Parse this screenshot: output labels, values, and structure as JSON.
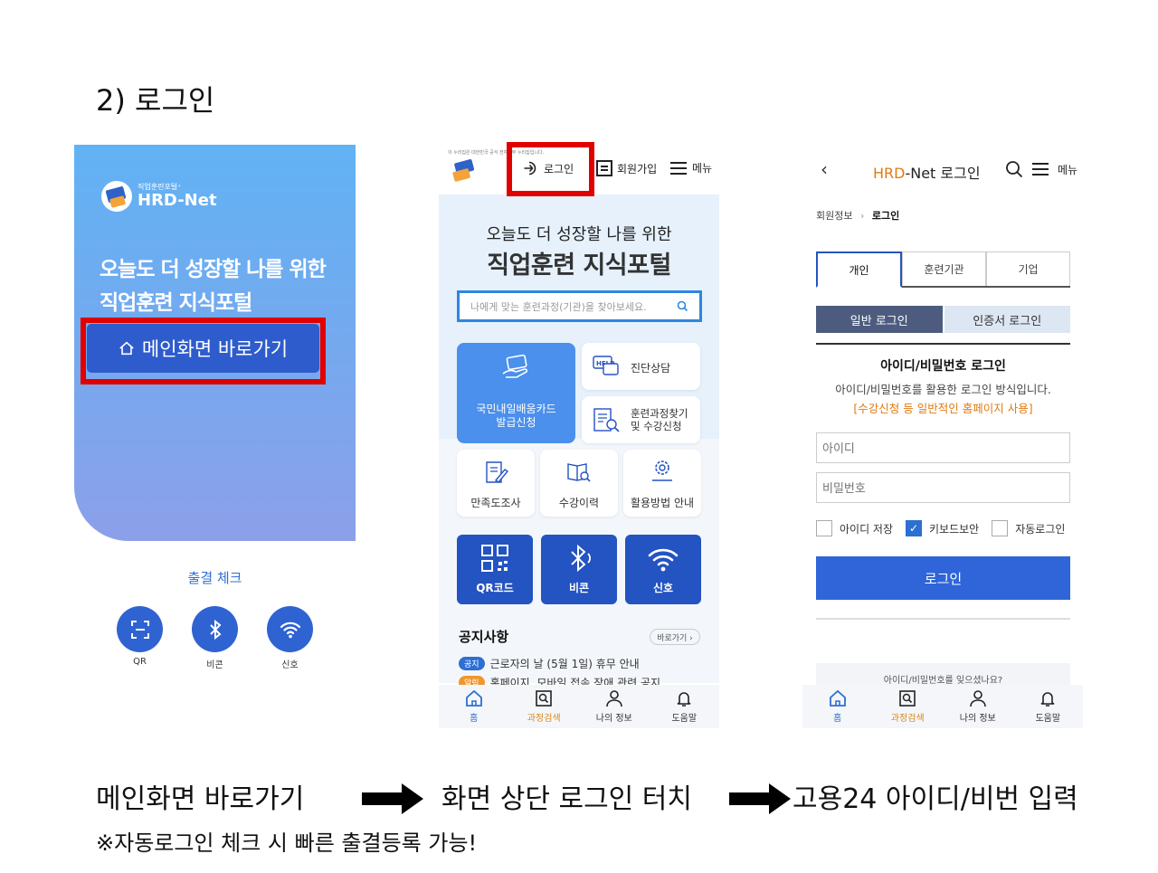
{
  "heading": "2) 로그인",
  "screen1": {
    "logo_small": "직업훈련포털⁺",
    "logo_big": "HRD-Net",
    "tagline_1": "오늘도 더 성장할 나를 위한",
    "tagline_2": "직업훈련 지식포털",
    "main_button": "메인화면 바로가기",
    "attendance_title": "출결 체크",
    "attendance_buttons": [
      "QR",
      "비콘",
      "신호"
    ]
  },
  "screen2": {
    "top_notice": "이 누리집은 대한민국 공식 전자정부 누리집입니다.",
    "login": "로그인",
    "join": "회원가입",
    "menu": "메뉴",
    "subtitle": "오늘도 더 성장할 나를 위한",
    "title": "직업훈련 지식포털",
    "search_placeholder": "나에게 맞는 훈련과정(기관)을 찾아보세요.",
    "tile_card": "국민내일배움카드 발급신청",
    "tile_card_line1": "국민내일배움카드",
    "tile_card_line2": "발급신청",
    "tile_diag": "진단상담",
    "tile_search_line1": "훈련과정찾기",
    "tile_search_line2": "및 수강신청",
    "tile_survey": "만족도조사",
    "tile_history": "수강이력",
    "tile_guide": "활용방법 안내",
    "att_qr": "QR코드",
    "att_beacon": "비콘",
    "att_signal": "신호",
    "notice_title": "공지사항",
    "notice_more": "바로가기 ›",
    "notices": [
      {
        "badge": "공지",
        "text": "근로자의 날 (5월 1일) 휴무 안내",
        "color": "#2e6fd2"
      },
      {
        "badge": "알림",
        "text": "홈페이지, 모바일 접속 장애 관련 공지",
        "color": "#f0962a"
      }
    ],
    "nav": [
      "홈",
      "과정검색",
      "나의 정보",
      "도움말"
    ]
  },
  "screen3": {
    "title_hrd": "HRD",
    "title_rest": "-Net 로그인",
    "menu": "메뉴",
    "crumb_1": "회원정보",
    "crumb_2": "로그인",
    "tabs": [
      "개인",
      "훈련기관",
      "기업"
    ],
    "seg_on": "일반 로그인",
    "seg_off": "인증서 로그인",
    "heading": "아이디/비밀번호 로그인",
    "desc": "아이디/비밀번호를 활용한 로그인 방식입니다.",
    "note": "[수강신청 등 일반적인 홈페이지 사용]",
    "id_placeholder": "아이디",
    "pw_placeholder": "비밀번호",
    "check_save": "아이디 저장",
    "check_keyboard": "키보드보안",
    "check_auto": "자동로그인",
    "login_button": "로그인",
    "find_text": "아이디/비밀번호를 잊으셨나요?",
    "nav": [
      "홈",
      "과정검색",
      "나의 정보",
      "도움말"
    ]
  },
  "captions": {
    "step1": "메인화면 바로가기",
    "step2": "화면 상단 로그인 터치",
    "step3": "고용24 아이디/비번 입력",
    "footnote": "※자동로그인 체크 시 빠른 출결등록 가능!"
  },
  "colors": {
    "accent_blue": "#2e5ccd",
    "highlight_red": "#e00000",
    "hrd_orange": "#e07a12"
  }
}
